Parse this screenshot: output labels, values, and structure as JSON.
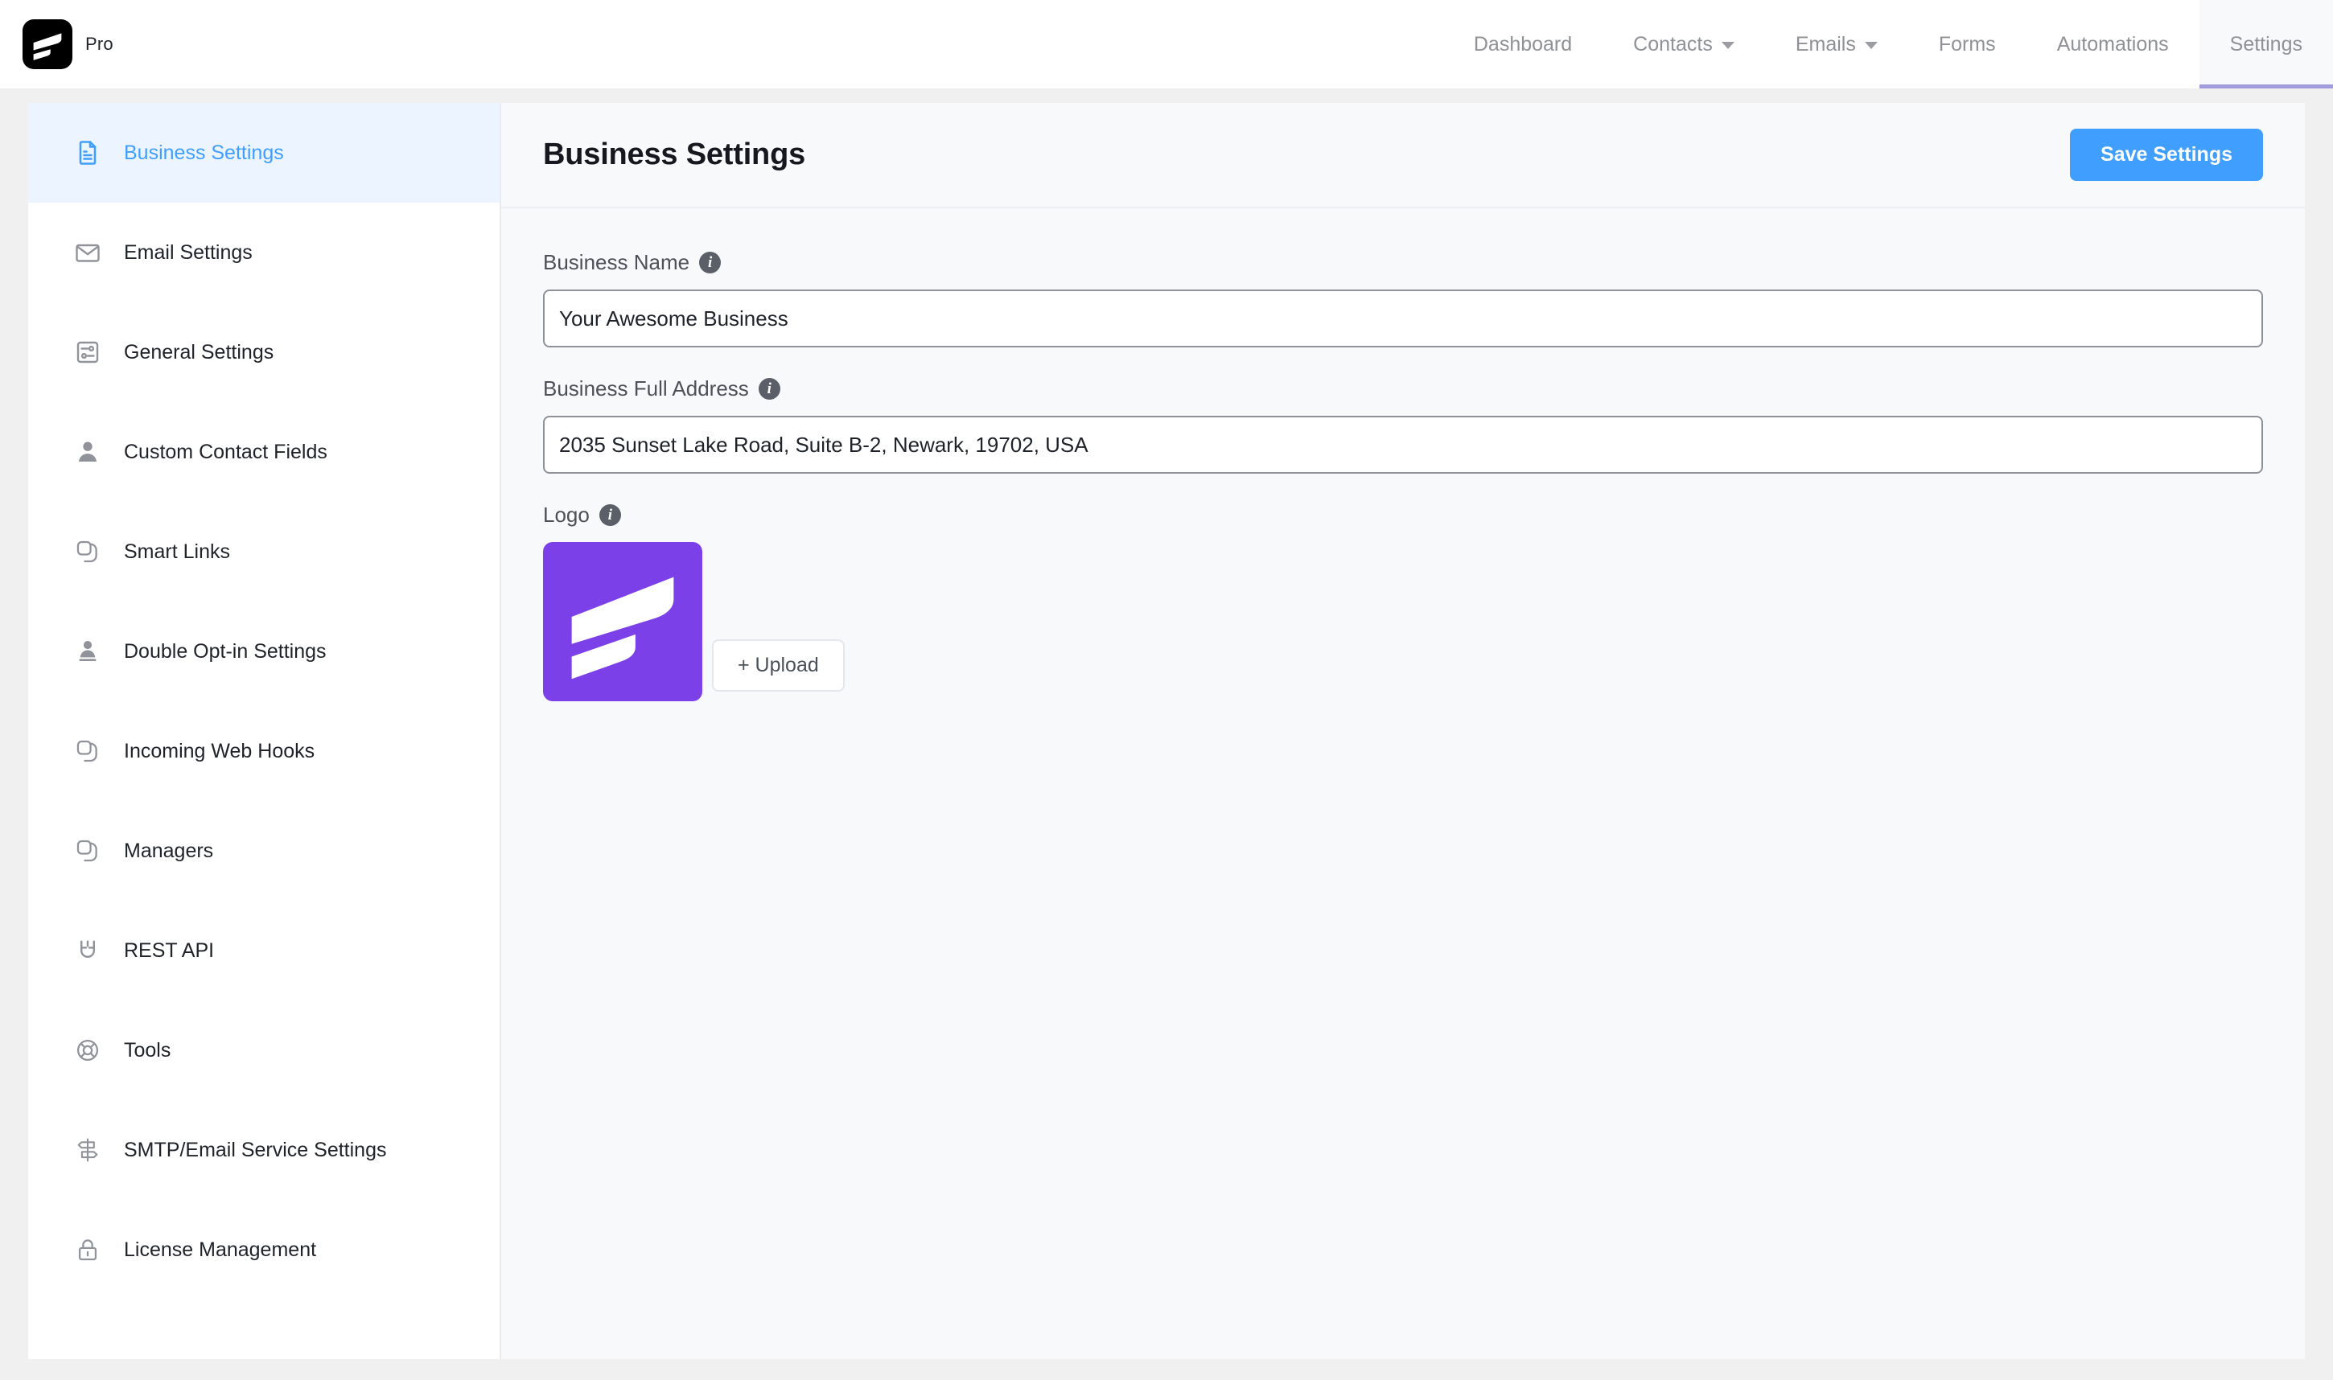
{
  "brand": {
    "logo_icon": "fluentcrm-mark-icon",
    "label": "Pro"
  },
  "nav": {
    "items": [
      {
        "label": "Dashboard",
        "has_caret": false,
        "active": false
      },
      {
        "label": "Contacts",
        "has_caret": true,
        "active": false
      },
      {
        "label": "Emails",
        "has_caret": true,
        "active": false
      },
      {
        "label": "Forms",
        "has_caret": false,
        "active": false
      },
      {
        "label": "Automations",
        "has_caret": false,
        "active": false
      },
      {
        "label": "Settings",
        "has_caret": false,
        "active": true
      }
    ],
    "active_underline_color": "#a29bdb"
  },
  "sidebar": {
    "items": [
      {
        "label": "Business Settings",
        "icon": "document-icon",
        "active": true
      },
      {
        "label": "Email Settings",
        "icon": "envelope-icon",
        "active": false
      },
      {
        "label": "General Settings",
        "icon": "sliders-icon",
        "active": false
      },
      {
        "label": "Custom Contact Fields",
        "icon": "user-icon",
        "active": false
      },
      {
        "label": "Smart Links",
        "icon": "link-icon",
        "active": false
      },
      {
        "label": "Double Opt-in Settings",
        "icon": "user-stamp-icon",
        "active": false
      },
      {
        "label": "Incoming Web Hooks",
        "icon": "link-icon",
        "active": false
      },
      {
        "label": "Managers",
        "icon": "link-icon",
        "active": false
      },
      {
        "label": "REST API",
        "icon": "magnet-icon",
        "active": false
      },
      {
        "label": "Tools",
        "icon": "lifebuoy-icon",
        "active": false
      },
      {
        "label": "SMTP/Email Service Settings",
        "icon": "signpost-icon",
        "active": false
      },
      {
        "label": "License Management",
        "icon": "lock-icon",
        "active": false
      }
    ],
    "active_bg": "#ecf5ff",
    "active_color": "#409eff"
  },
  "main": {
    "title": "Business Settings",
    "save_label": "Save Settings",
    "save_color": "#409eff",
    "fields": {
      "business_name": {
        "label": "Business Name",
        "value": "Your Awesome Business",
        "placeholder": "Business Name",
        "info_icon": "info-icon"
      },
      "business_address": {
        "label": "Business Full Address",
        "value": "2035 Sunset Lake Road, Suite B-2, Newark, 19702, USA",
        "placeholder": "Business Full Address",
        "info_icon": "info-icon"
      },
      "logo": {
        "label": "Logo",
        "info_icon": "info-icon",
        "upload_label": "+ Upload",
        "logo_color": "#7b40e8",
        "logo_icon": "fluentcrm-mark-icon"
      }
    }
  }
}
